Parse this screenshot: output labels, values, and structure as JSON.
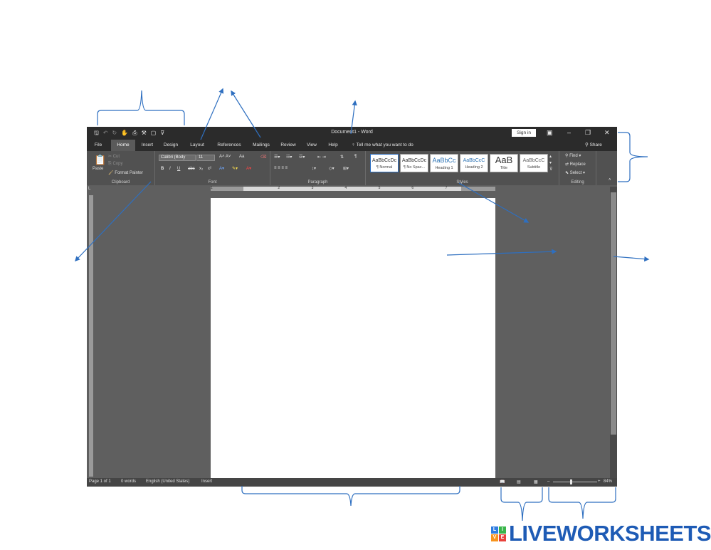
{
  "window": {
    "title": "Document1  -  Word",
    "sign_in": "Sign in",
    "share": "Share"
  },
  "quick_access": [
    "save-icon",
    "undo-icon",
    "redo-icon",
    "touch-mode-icon",
    "print-preview-icon",
    "format-painter-icon",
    "new-document-icon",
    "customize-icon"
  ],
  "tabs": [
    "File",
    "Home",
    "Insert",
    "Design",
    "Layout",
    "References",
    "Mailings",
    "Review",
    "View",
    "Help"
  ],
  "active_tab": "Home",
  "tell_me": "Tell me what you want to do",
  "ribbon": {
    "clipboard": {
      "label": "Clipboard",
      "paste": "Paste",
      "cut": "Cut",
      "copy": "Copy",
      "format_painter": "Format Painter"
    },
    "font": {
      "label": "Font",
      "font_name": "Calibri (Body",
      "font_size": "11",
      "change_case": "Aa",
      "bold": "B",
      "italic": "I",
      "underline": "U",
      "strikethrough": "abc",
      "subscript": "x₂",
      "superscript": "x²"
    },
    "paragraph": {
      "label": "Paragraph"
    },
    "styles": {
      "label": "Styles",
      "items": [
        {
          "sample": "AaBbCcDc",
          "name": "¶ Normal"
        },
        {
          "sample": "AaBbCcDc",
          "name": "¶ No Spac..."
        },
        {
          "sample": "AaBbCc",
          "name": "Heading 1"
        },
        {
          "sample": "AaBbCcC",
          "name": "Heading 2"
        },
        {
          "sample": "AaB",
          "name": "Title"
        },
        {
          "sample": "AaBbCcC",
          "name": "Subtitle"
        }
      ]
    },
    "editing": {
      "label": "Editing",
      "find": "Find",
      "replace": "Replace",
      "select": "Select"
    }
  },
  "status": {
    "page": "Page 1 of 1",
    "words": "0 words",
    "language": "English (United States)",
    "mode": "Insert",
    "zoom": "84%"
  },
  "ruler_marks": [
    "1",
    "2",
    "3",
    "4",
    "5",
    "6",
    "7"
  ],
  "logo": {
    "tiles": [
      "L",
      "I",
      "V",
      "E"
    ],
    "text": "LIVEWORKSHEETS"
  },
  "colors": {
    "accent": "#2e6fc0",
    "titlebar": "#2b2b2b",
    "ribbon": "#515151",
    "workspace": "#5f5f5f"
  }
}
